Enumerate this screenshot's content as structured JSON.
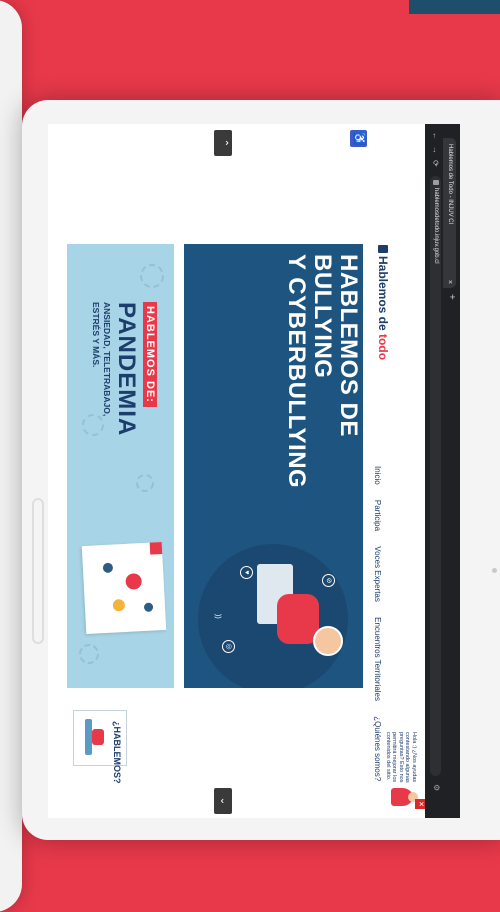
{
  "browser": {
    "tab_title": "Hablemos de Todo - INJUV Cl",
    "tab_close": "×",
    "tab_new": "+",
    "url": "hablemosdetodo.injuv.gob.cl",
    "back_icon": "←",
    "forward_icon": "→",
    "reload_icon": "⟳"
  },
  "site": {
    "logo_text_1": "Hablemos de ",
    "logo_text_2": "todo",
    "access_icon": "♿",
    "scroll_up": "⌃",
    "scroll_down": "⌄",
    "nav": [
      "Inicio",
      "Participa",
      "Voces Expertas",
      "Encuentros Territoriales",
      "¿Quiénes somos?"
    ],
    "chat": {
      "text": "Hola :) ¿Nos ayudas contestando algunas preguntas? Esto nos permitirá mejorar los contenidos del sitio.",
      "close": "✕"
    }
  },
  "hero": {
    "title_line1": "HABLEMOS DE BULLYING",
    "title_line2": "Y CYBERBULLYING",
    "chip_a": "⊘",
    "chip_b": "◎",
    "chip_c": "♥",
    "wifi": "))"
  },
  "pandemia": {
    "tag": "HABLEMOS DE:",
    "title": "PANDEMIA",
    "subtitle": "ANSIEDAD, TELETRABAJO, ESTRÉS Y MÁS."
  },
  "ad": {
    "text": "¿HABLEMOS?"
  }
}
